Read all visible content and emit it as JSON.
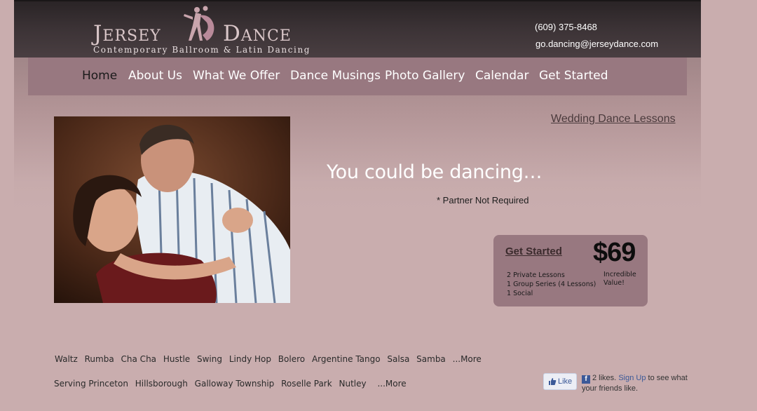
{
  "header": {
    "logo_left": "Jersey",
    "logo_right": "Dance",
    "tagline": "Contemporary Ballroom & Latin Dancing",
    "phone": "(609) 375-8468",
    "email": "go.dancing@jerseydance.com"
  },
  "nav": {
    "items": [
      {
        "label": "Home",
        "active": true
      },
      {
        "label": "About Us"
      },
      {
        "label": "What We Offer"
      },
      {
        "label": "Dance Musings"
      },
      {
        "label": "Photo Gallery"
      },
      {
        "label": "Calendar"
      },
      {
        "label": "Get Started"
      }
    ]
  },
  "main": {
    "wedding_link": "Wedding Dance Lessons",
    "headline": "You could be dancing…",
    "subnote": "* Partner Not Required"
  },
  "promo": {
    "cta": "Get Started",
    "price": "$69",
    "lines": [
      "2 Private Lessons",
      "1 Group Series (4 Lessons)",
      "1 Social"
    ],
    "value_note": "Incredible Value!"
  },
  "dances": {
    "items": [
      "Waltz",
      "Rumba",
      "Cha Cha",
      "Hustle",
      "Swing",
      "Lindy Hop",
      "Bolero",
      "Argentine Tango",
      "Salsa",
      "Samba"
    ],
    "more": "...More"
  },
  "areas": {
    "items": [
      "Serving Princeton",
      "Hillsborough",
      "Galloway Township",
      "Roselle Park",
      "Nutley"
    ],
    "more": "...More"
  },
  "facebook": {
    "like_label": "Like",
    "likes_text": "2 likes.",
    "signup": "Sign Up",
    "suffix": "to see what your friends like."
  },
  "colors": {
    "background": "#c9adae",
    "nav": "#987880",
    "header": "#3c3336"
  }
}
